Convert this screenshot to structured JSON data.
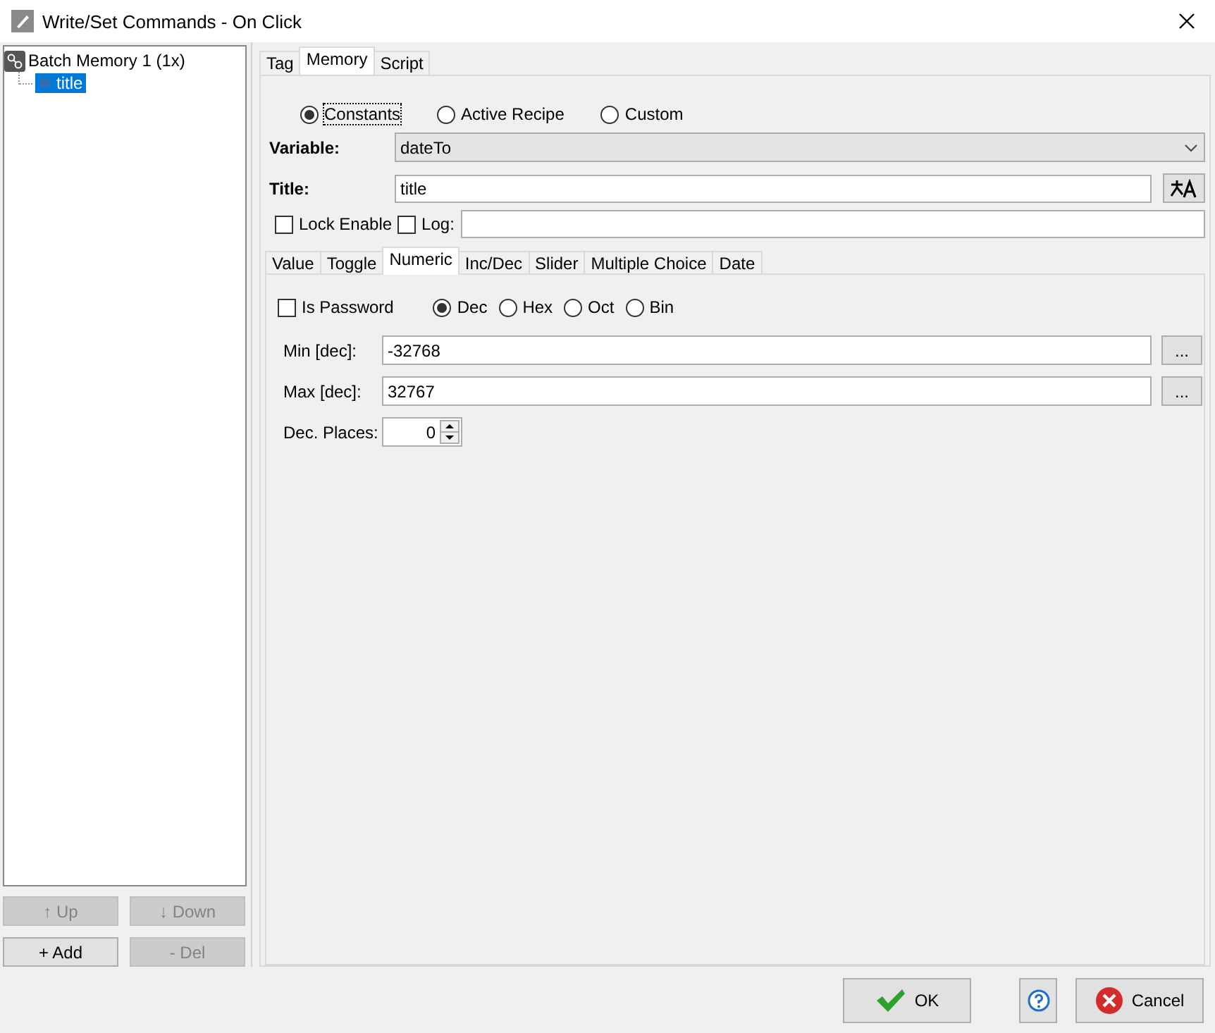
{
  "window": {
    "title": "Write/Set Commands - On Click"
  },
  "tree": {
    "items": [
      {
        "label": "Batch Memory 1 (1x)",
        "selected": false,
        "children": [
          {
            "label": "title",
            "selected": true
          }
        ]
      }
    ]
  },
  "list_buttons": [
    {
      "label": "↑ Up",
      "disabled": true
    },
    {
      "label": "↓ Down",
      "disabled": true
    },
    {
      "label": "+ Add",
      "disabled": false
    },
    {
      "label": "- Del",
      "disabled": true
    }
  ],
  "tabs": [
    {
      "label": "Tag",
      "selected": false
    },
    {
      "label": "Memory",
      "selected": true
    },
    {
      "label": "Script",
      "selected": false
    }
  ],
  "source": [
    {
      "label": "Constants",
      "selected": true
    },
    {
      "label": "Active Recipe",
      "selected": false
    },
    {
      "label": "Custom",
      "selected": false
    }
  ],
  "variable": {
    "label": "Variable:",
    "value": "dateTo"
  },
  "title_field": {
    "label": "Title:",
    "value": "title"
  },
  "lock_enable": {
    "label": "Lock Enable",
    "checked": false
  },
  "log": {
    "label": "Log:",
    "checked": false
  },
  "type_tabs": [
    {
      "label": "Value",
      "selected": false
    },
    {
      "label": "Toggle",
      "selected": false
    },
    {
      "label": "Numeric",
      "selected": true
    },
    {
      "label": "Inc/Dec",
      "selected": false
    },
    {
      "label": "Slider",
      "selected": false
    },
    {
      "label": "Multiple Choice",
      "selected": false
    },
    {
      "label": "Date",
      "selected": false
    }
  ],
  "is_password": {
    "label": "Is Password",
    "checked": false
  },
  "base": [
    {
      "label": "Dec",
      "selected": true
    },
    {
      "label": "Hex",
      "selected": false
    },
    {
      "label": "Oct",
      "selected": false
    },
    {
      "label": "Bin",
      "selected": false
    }
  ],
  "min": {
    "label": "Min [dec]:",
    "value": "-32768",
    "button": "..."
  },
  "max": {
    "label": "Max [dec]:",
    "value": "32767",
    "button": "..."
  },
  "dec_places": {
    "label": "Dec. Places:",
    "value": "0"
  },
  "buttons": [
    {
      "kind": "ok",
      "label": "OK"
    },
    {
      "kind": "help"
    },
    {
      "kind": "cancel",
      "label": "Cancel"
    }
  ]
}
